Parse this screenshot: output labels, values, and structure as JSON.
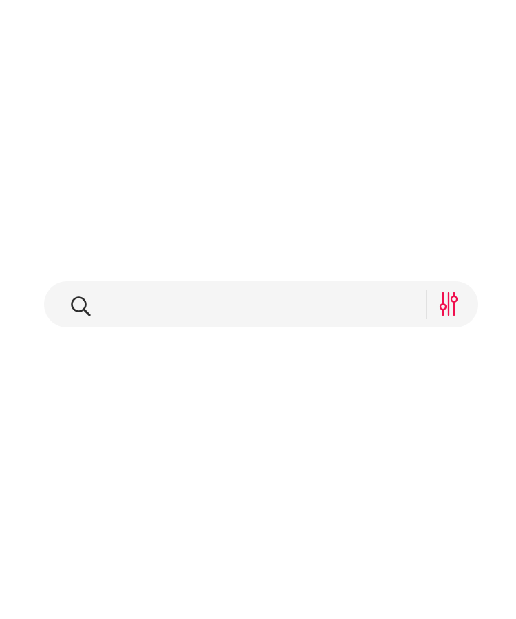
{
  "search": {
    "value": "",
    "placeholder": "",
    "icon": "search-icon"
  },
  "filter": {
    "icon": "sliders-filter-icon",
    "accent_color": "#f0104f"
  },
  "colors": {
    "search_background": "#f5f5f5",
    "icon_dark": "#2d2d2d",
    "divider": "#e1e1e1"
  }
}
